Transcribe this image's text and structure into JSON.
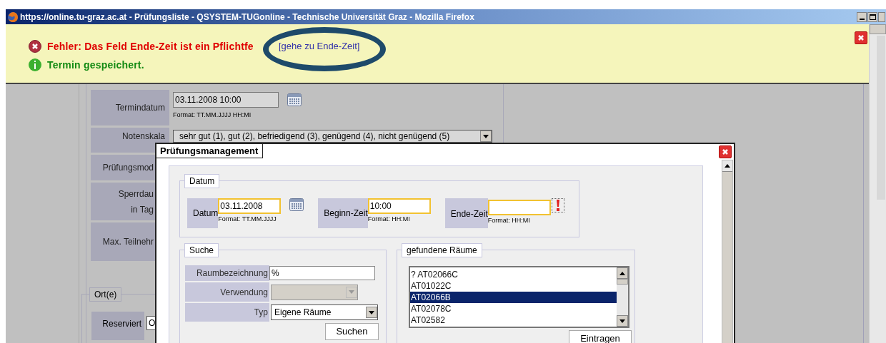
{
  "window": {
    "title": "https://online.tu-graz.ac.at - Prüfungsliste - QSYSTEM-TUGonline - Technische Universität Graz - Mozilla Firefox"
  },
  "messages": [
    {
      "kind": "error",
      "text": "Fehler: Das Feld Ende-Zeit ist ein Pflichtfe",
      "link": "[gehe zu Ende-Zeit]"
    },
    {
      "kind": "info",
      "text": "Termin gespeichert."
    }
  ],
  "background_form": {
    "rows": [
      {
        "label": "Termindatum",
        "kind": "date",
        "value": "03.11.2008 10:00",
        "hint": "Format: TT.MM.JJJJ HH:MI"
      },
      {
        "label": "Notenskala",
        "kind": "select",
        "value": "sehr gut (1), gut (2), befriedigend (3), genügend (4), nicht genügend (5)"
      },
      {
        "label": "Prüfungsmod",
        "kind": "hidden"
      },
      {
        "label": "Sperrdau\nin Tag",
        "kind": "hidden"
      },
      {
        "label": "Max. Teilnehr",
        "kind": "hidden"
      }
    ],
    "section": {
      "legend": "Ort(e)",
      "rows": [
        {
          "label": "Reserviert",
          "value": "O"
        }
      ]
    }
  },
  "dialog": {
    "title": "Prüfungsmanagement",
    "datum": {
      "legend": "Datum",
      "fields": [
        {
          "label": "Datum",
          "value": "03.11.2008",
          "hint": "Format: TT.MM.JJJJ",
          "calendar": true,
          "error": false
        },
        {
          "label": "Beginn-Zeit",
          "value": "10:00",
          "hint": "Format: HH:MI",
          "calendar": false,
          "error": false
        },
        {
          "label": "Ende-Zeit",
          "hint": "Format: HH:MI",
          "calendar": false,
          "error": true
        }
      ]
    },
    "suche": {
      "legend": "Suche",
      "fields": [
        {
          "label": "Raumbezeichnung",
          "kind": "text",
          "value": "%",
          "disabled": false
        },
        {
          "label": "Verwendung",
          "kind": "select",
          "disabled": true
        },
        {
          "label": "Typ",
          "kind": "select",
          "value": "Eigene Räume",
          "disabled": false
        }
      ],
      "button": "Suchen"
    },
    "rooms": {
      "legend": "gefundene Räume",
      "items": [
        {
          "label": "? AT02066C",
          "selected": false
        },
        {
          "label": "AT01022C",
          "selected": false
        },
        {
          "label": "AT02066B",
          "selected": true
        },
        {
          "label": "AT02078C",
          "selected": false
        },
        {
          "label": "AT02582",
          "selected": false
        }
      ],
      "button": "Eintragen"
    }
  }
}
